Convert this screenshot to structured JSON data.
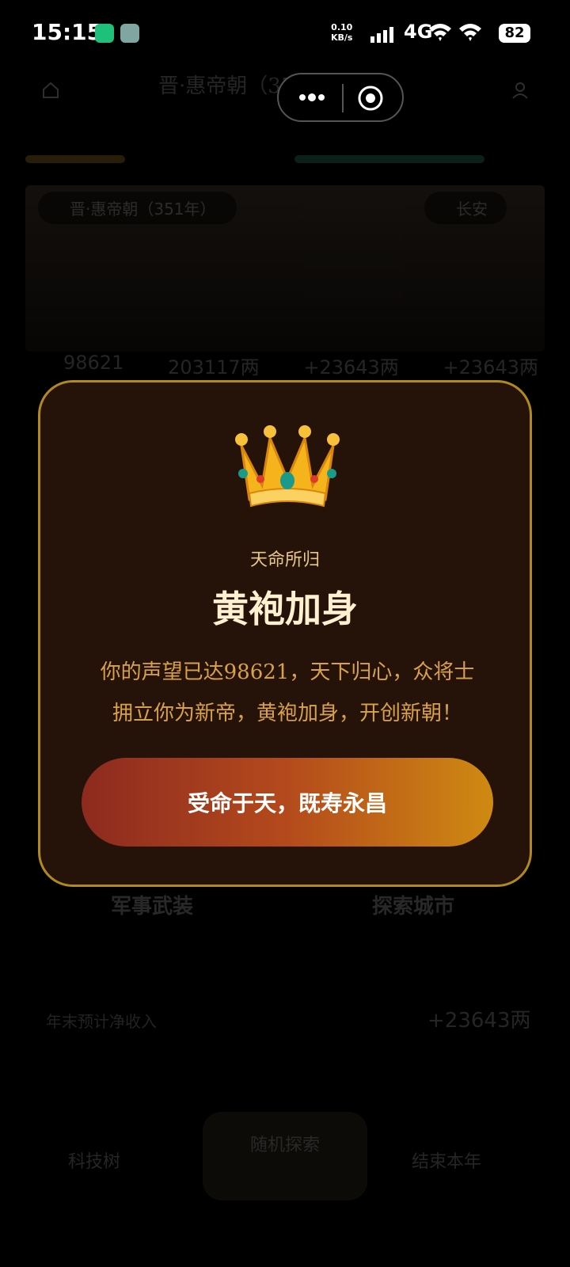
{
  "status_bar": {
    "time": "15:15",
    "net_speed_value": "0.10",
    "net_speed_unit": "KB/s",
    "network": "4G",
    "battery": "82",
    "icons": [
      "app-shield-icon",
      "avatar-notification-icon",
      "signal-icon",
      "wifi-icon",
      "wifi-icon",
      "battery-icon"
    ]
  },
  "background": {
    "header_title": "晋·惠帝朝（351年）· 长安",
    "banner_tag_left": "晋·惠帝朝（351年）",
    "banner_tag_right": "长安",
    "stats": [
      "98621",
      "203117两",
      "+23643两",
      "+23643两"
    ],
    "section_left_title": "军事武装",
    "section_right_title": "探索城市",
    "income_label": "年末预计净收入",
    "income_value": "+23643两",
    "bottom_left": "科技树",
    "bottom_mid_title": "随机探索",
    "bottom_right": "结束本年",
    "colors": {
      "bar_left": "#d6a236",
      "bar_right": "#37b184"
    }
  },
  "modal": {
    "icon": "crown-icon",
    "pretitle": "天命所归",
    "title": "黄袍加身",
    "body_line1": "你的声望已达98621，天下归心，众将士",
    "body_line2": "拥立你为新帝，黄袍加身，开创新朝！",
    "confirm_label": "受命于天，既寿永昌",
    "colors": {
      "border": "#b08a1e",
      "background": "#251208",
      "title": "#fff1cf",
      "body": "#d9a24a",
      "button_start": "#8d2a1f",
      "button_end": "#cf8a12"
    }
  }
}
